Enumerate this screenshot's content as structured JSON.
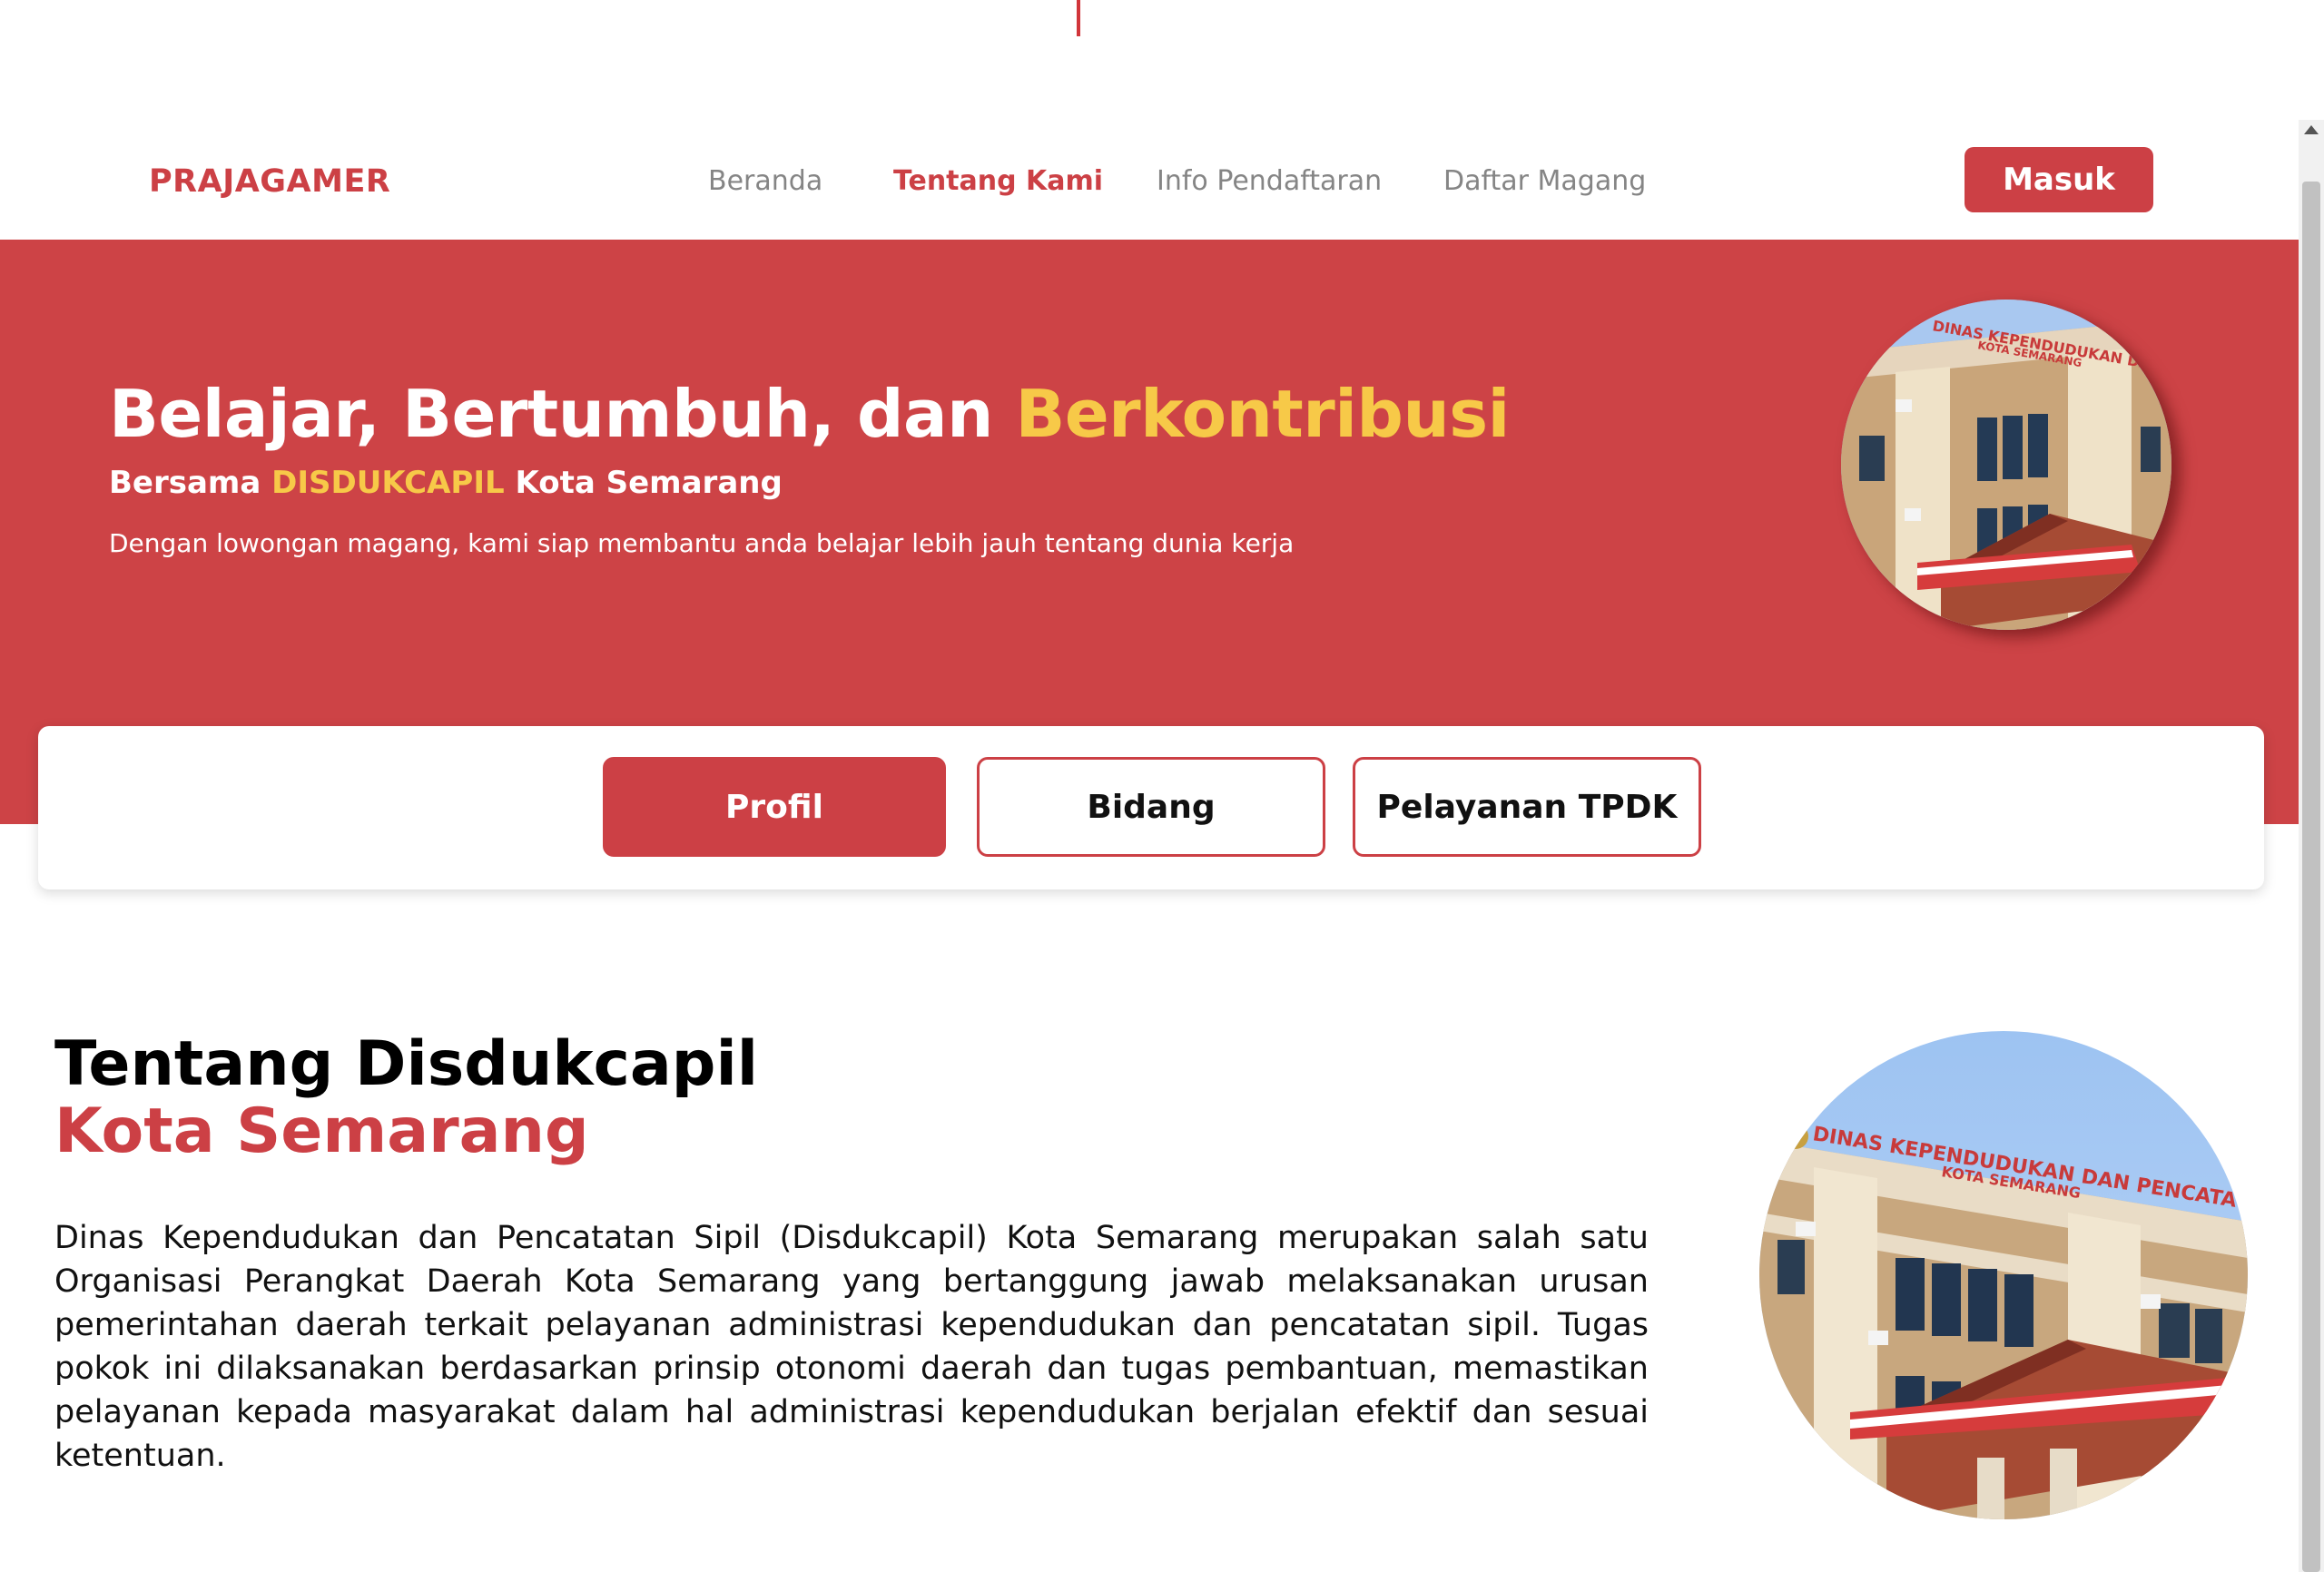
{
  "navbar": {
    "brand": "PRAJAGAMER",
    "links": [
      {
        "label": "Beranda",
        "active": false
      },
      {
        "label": "Tentang Kami",
        "active": true
      },
      {
        "label": "Info Pendaftaran",
        "active": false
      },
      {
        "label": "Daftar Magang",
        "active": false
      }
    ],
    "login_label": "Masuk"
  },
  "hero": {
    "title_main": "Belajar, Bertumbuh, dan ",
    "title_accent": "Berkontribusi",
    "subtitle_prefix": "Bersama ",
    "subtitle_accent": "DISDUKCAPIL",
    "subtitle_suffix": " Kota Semarang",
    "description": "Dengan lowongan magang, kami siap membantu anda belajar lebih jauh tentang dunia kerja",
    "photo_sign": "DINAS KEPENDUDUKAN DAN PENCATATAN SIPIL",
    "photo_sign_sub": "KOTA SEMARANG"
  },
  "tabs": [
    {
      "label": "Profil",
      "active": true
    },
    {
      "label": "Bidang",
      "active": false
    },
    {
      "label": "Pelayanan TPDK",
      "active": false
    }
  ],
  "about": {
    "title_line1": "Tentang Disdukcapil",
    "title_line2": "Kota Semarang",
    "body": "Dinas Kependudukan dan Pencatatan Sipil (Disdukcapil) Kota Semarang merupakan salah satu Organisasi Perangkat Daerah Kota Semarang yang bertanggung jawab melaksanakan urusan pemerintahan daerah terkait pelayanan administrasi kependudukan dan pencatatan sipil. Tugas pokok ini dilaksanakan berdasarkan prinsip otonomi daerah dan tugas pembantuan, memastikan pelayanan kepada masyarakat dalam hal administrasi kependudukan berjalan efektif dan sesuai ketentuan."
  },
  "colors": {
    "primary": "#cd4346",
    "accent": "#f7c948",
    "nav_inactive": "#858585"
  }
}
